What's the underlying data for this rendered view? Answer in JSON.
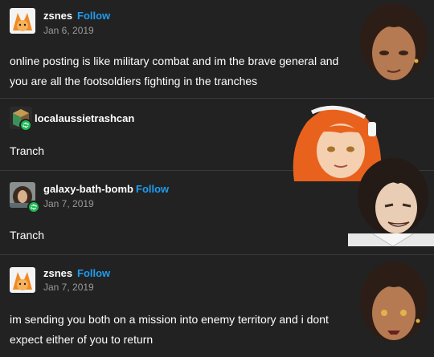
{
  "posts": [
    {
      "username": "zsnes",
      "follow": "Follow",
      "date": "Jan 6, 2019",
      "text": "online posting is like military combat and im the brave general and you are all the footsoldiers fighting in the tranches"
    },
    {
      "username": "localaussietrashcan",
      "text": "Tranch"
    },
    {
      "username": "galaxy-bath-bomb",
      "follow": "Follow",
      "date": "Jan 7, 2019",
      "text": "Tranch"
    },
    {
      "username": "zsnes",
      "follow": "Follow",
      "date": "Jan 7, 2019",
      "text": "im sending you both on a mission into enemy territory and i dont expect either of you to return"
    }
  ],
  "colors": {
    "background": "#222222",
    "follow": "#1e9cf0",
    "date": "#9a9a9a",
    "reblog": "#1db954"
  }
}
